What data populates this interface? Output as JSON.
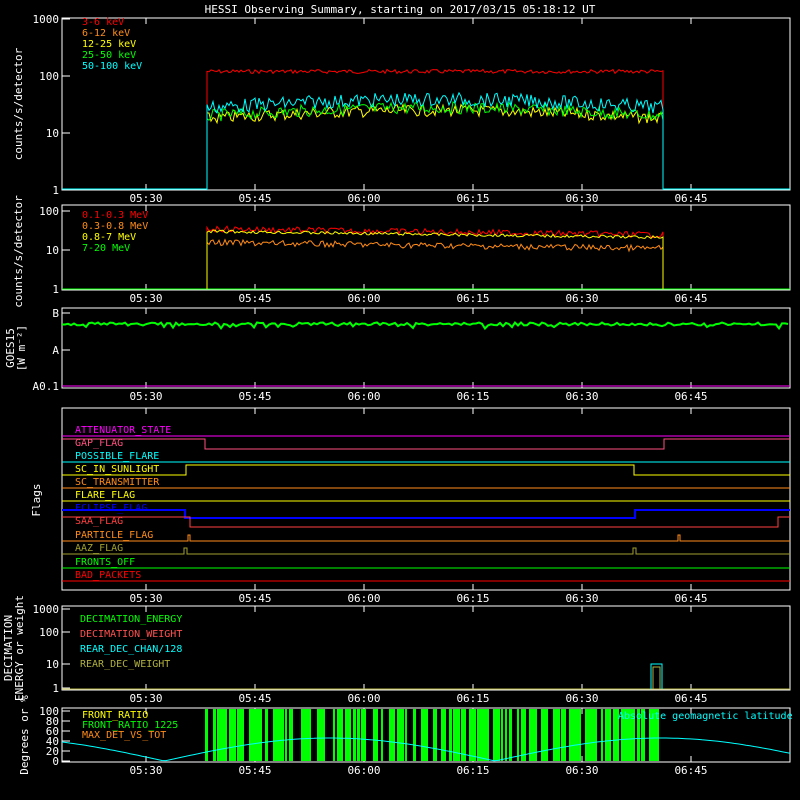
{
  "title": "HESSI Observing Summary, starting on 2017/03/15 05:18:12 UT",
  "time_axis": [
    "05:30",
    "05:45",
    "06:00",
    "06:15",
    "06:30",
    "06:45"
  ],
  "panels": {
    "xray": {
      "ylabel": "counts/s/detector",
      "yticks": [
        "1000",
        "100",
        "10",
        "1"
      ],
      "legend": [
        {
          "name": "3-6 keV",
          "color": "#ff0000"
        },
        {
          "name": "6-12 keV",
          "color": "#ff8c1a"
        },
        {
          "name": "12-25 keV",
          "color": "#ffff00"
        },
        {
          "name": "25-50 keV",
          "color": "#00ff00"
        },
        {
          "name": "50-100 keV",
          "color": "#00ffff"
        }
      ]
    },
    "gamma": {
      "ylabel": "counts/s/detector",
      "yticks": [
        "100",
        "10",
        "1"
      ],
      "legend": [
        {
          "name": "0.1-0.3 MeV",
          "color": "#ff0000"
        },
        {
          "name": "0.3-0.8 MeV",
          "color": "#ff8c1a"
        },
        {
          "name": "0.8-7 MeV",
          "color": "#ffff00"
        },
        {
          "name": "7-20 MeV",
          "color": "#00ff00"
        }
      ]
    },
    "goes": {
      "ylabel1": "GOES15",
      "ylabel2": "[W m⁻²]",
      "yticks": [
        "B",
        "A",
        "A0.1"
      ]
    },
    "flags": {
      "ylabel": "Flags",
      "items": [
        {
          "name": "ATTENUATOR_STATE",
          "color": "#ff00ff"
        },
        {
          "name": "GAP_FLAG",
          "color": "#ff5080"
        },
        {
          "name": "POSSIBLE_FLARE",
          "color": "#00ffff"
        },
        {
          "name": "SC_IN_SUNLIGHT",
          "color": "#ffff00"
        },
        {
          "name": "SC_TRANSMITTER",
          "color": "#ff8c1a"
        },
        {
          "name": "FLARE_FLAG",
          "color": "#ffff00"
        },
        {
          "name": "ECLIPSE_FLAG",
          "color": "#0000ff"
        },
        {
          "name": "SAA_FLAG",
          "color": "#ff4040"
        },
        {
          "name": "PARTICLE_FLAG",
          "color": "#ff8c1a"
        },
        {
          "name": "AAZ_FLAG",
          "color": "#a0a030"
        },
        {
          "name": "FRONTS_OFF",
          "color": "#00ff00"
        },
        {
          "name": "BAD_PACKETS",
          "color": "#ff0000"
        }
      ]
    },
    "decimation": {
      "ylabel1": "DECIMATION",
      "ylabel2": "ENERGY or weight",
      "yticks": [
        "1000",
        "100",
        "10",
        "1"
      ],
      "legend": [
        {
          "name": "DECIMATION_ENERGY",
          "color": "#00ff00"
        },
        {
          "name": "DECIMATION_WEIGHT",
          "color": "#ff5050"
        },
        {
          "name": "REAR_DEC_CHAN/128",
          "color": "#00ffff"
        },
        {
          "name": "REAR_DEC_WEIGHT",
          "color": "#b0b040"
        }
      ]
    },
    "ratio": {
      "ylabel": "Degrees or %",
      "yticks": [
        "100",
        "80",
        "60",
        "40",
        "20",
        "0"
      ],
      "legend": [
        {
          "name": "FRONT_RATIO",
          "color": "#ffff00"
        },
        {
          "name": "FRONT_RATIO_1225",
          "color": "#00ff00"
        },
        {
          "name": "MAX_DET_VS_TOT",
          "color": "#ff8c1a"
        }
      ],
      "right_label": "Absolute geomagnetic latitude",
      "right_label_color": "#00ffff"
    }
  },
  "chart_data": {
    "type": "line",
    "title": "HESSI Observing Summary, starting on 2017/03/15 05:18:12 UT",
    "x_range": [
      "05:18:12",
      "06:58:00"
    ],
    "observation_window": [
      "05:37",
      "06:41"
    ],
    "xray_series": [
      {
        "name": "3-6 keV",
        "level": 120
      },
      {
        "name": "6-12 keV",
        "level": 25
      },
      {
        "name": "12-25 keV",
        "level": 18
      },
      {
        "name": "25-50 keV",
        "level": 20
      },
      {
        "name": "50-100 keV",
        "level": 28
      }
    ],
    "gamma_series": [
      {
        "name": "0.1-0.3 MeV",
        "level": 35
      },
      {
        "name": "0.3-0.8 MeV",
        "level": 25
      },
      {
        "name": "0.8-7 MeV",
        "level": 30
      },
      {
        "name": "7-20 MeV",
        "level": 1
      }
    ],
    "goes_level": "B"
  }
}
